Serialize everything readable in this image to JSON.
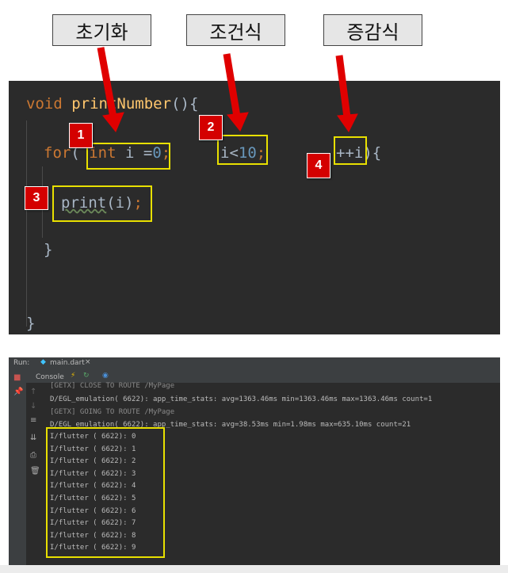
{
  "annotations": {
    "labels": [
      "초기화",
      "조건식",
      "증감식"
    ],
    "badges": [
      "1",
      "2",
      "3",
      "4"
    ]
  },
  "code": {
    "line1": {
      "kw": "void",
      "fn": "printNumber",
      "rest": "(){"
    },
    "line2": {
      "kw": "for",
      "open": "( ",
      "init_type": "int",
      "init_rest": " i =",
      "init_num": "0",
      "init_semi": ";"
    },
    "line2_cond": {
      "var": "i<",
      "num": "10",
      "semi": ";"
    },
    "line2_inc": {
      "op": "++i",
      "close": "){"
    },
    "line3": {
      "call": "print",
      "args": "(i)",
      "semi": ";"
    },
    "line4": "}",
    "line5": "}"
  },
  "run_panel": {
    "run_label": "Run:",
    "tab_label": "main.dart",
    "tab_close": "×",
    "console_tab": "Console",
    "lines": [
      "[GETX] CLOSE TO ROUTE /MyPage",
      "D/EGL_emulation( 6622): app_time_stats: avg=1363.46ms min=1363.46ms max=1363.46ms count=1",
      "[GETX] GOING TO ROUTE /MyPage",
      "D/EGL_emulation( 6622): app_time_stats: avg=38.53ms min=1.98ms max=635.10ms count=21",
      "I/flutter ( 6622): 0",
      "I/flutter ( 6622): 1",
      "I/flutter ( 6622): 2",
      "I/flutter ( 6622): 3",
      "I/flutter ( 6622): 4",
      "I/flutter ( 6622): 5",
      "I/flutter ( 6622): 6",
      "I/flutter ( 6622): 7",
      "I/flutter ( 6622): 8",
      "I/flutter ( 6622): 9"
    ]
  },
  "colors": {
    "arrow": "#e00000",
    "highlight": "#e8e000",
    "badge": "#d40000",
    "code_bg": "#2b2b2b"
  }
}
